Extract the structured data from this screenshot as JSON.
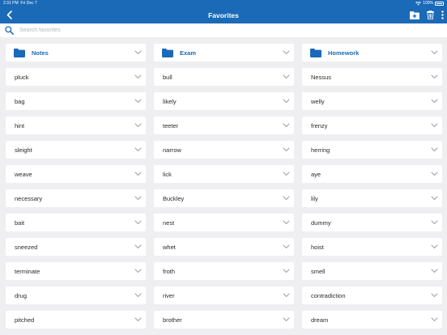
{
  "status": {
    "time": "2:31 PM",
    "date": "Fri Dec 7",
    "battery": "100%"
  },
  "navbar": {
    "title": "Favorites"
  },
  "search": {
    "placeholder": "Search favorites",
    "value": ""
  },
  "folders": [
    "Notes",
    "Exam",
    "Homework"
  ],
  "rows": [
    [
      "pluck",
      "bull",
      "Nessus"
    ],
    [
      "bag",
      "likely",
      "welly"
    ],
    [
      "hint",
      "teeter",
      "frenzy"
    ],
    [
      "sleight",
      "narrow",
      "herring"
    ],
    [
      "weave",
      "lick",
      "aye"
    ],
    [
      "necessary",
      "Buckley",
      "lily"
    ],
    [
      "bait",
      "nest",
      "dummy"
    ],
    [
      "sneezed",
      "whet",
      "hoist"
    ],
    [
      "terminate",
      "froth",
      "smell"
    ],
    [
      "drug",
      "river",
      "contradiction"
    ],
    [
      "pitched",
      "brother",
      "dream"
    ]
  ],
  "colors": {
    "brand": "#1b6ab7",
    "background": "#efeff1",
    "card": "#ffffff"
  }
}
